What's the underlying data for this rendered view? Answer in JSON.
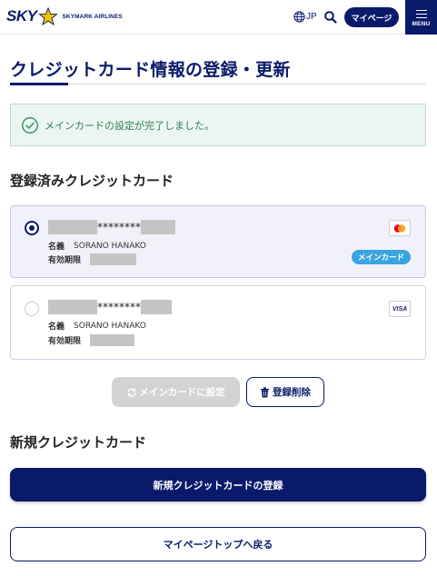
{
  "header": {
    "logo_text": "SKY",
    "logo_subtext": "SKYMARK AIRLINES",
    "language": "JP",
    "mypage_label": "マイページ",
    "menu_label": "MENU",
    "icons": {
      "language": "globe-icon",
      "search": "search-icon",
      "menu": "hamburger-icon"
    }
  },
  "page": {
    "title": "クレジットカード情報の登録・更新"
  },
  "notice": {
    "text": "メインカードの設定が完了しました。",
    "icon": "check-circle-icon",
    "color": "#2f7b5b"
  },
  "registered": {
    "heading": "登録済みクレジットカード",
    "cards": [
      {
        "selected": true,
        "number_masked": "********",
        "name_label": "名義",
        "name_value": "SORANO HANAKO",
        "expiry_label": "有効期限",
        "brand": "mastercard-icon",
        "badge": "メインカード"
      },
      {
        "selected": false,
        "number_masked": "********",
        "name_label": "名義",
        "name_value": "SORANO HANAKO",
        "expiry_label": "有効期限",
        "brand": "visa-icon",
        "brand_text": "VISA"
      }
    ],
    "set_main_label": "メインカードに設定",
    "delete_label": "登録削除"
  },
  "new_card": {
    "heading": "新規クレジットカード",
    "register_label": "新規クレジットカードの登録"
  },
  "back_label": "マイページトップへ戻る",
  "colors": {
    "brand_navy": "#0a1a6b",
    "badge_blue": "#3ba3e0",
    "success_bg": "#ecf6f1",
    "disabled_gray": "#d3d3d3"
  }
}
